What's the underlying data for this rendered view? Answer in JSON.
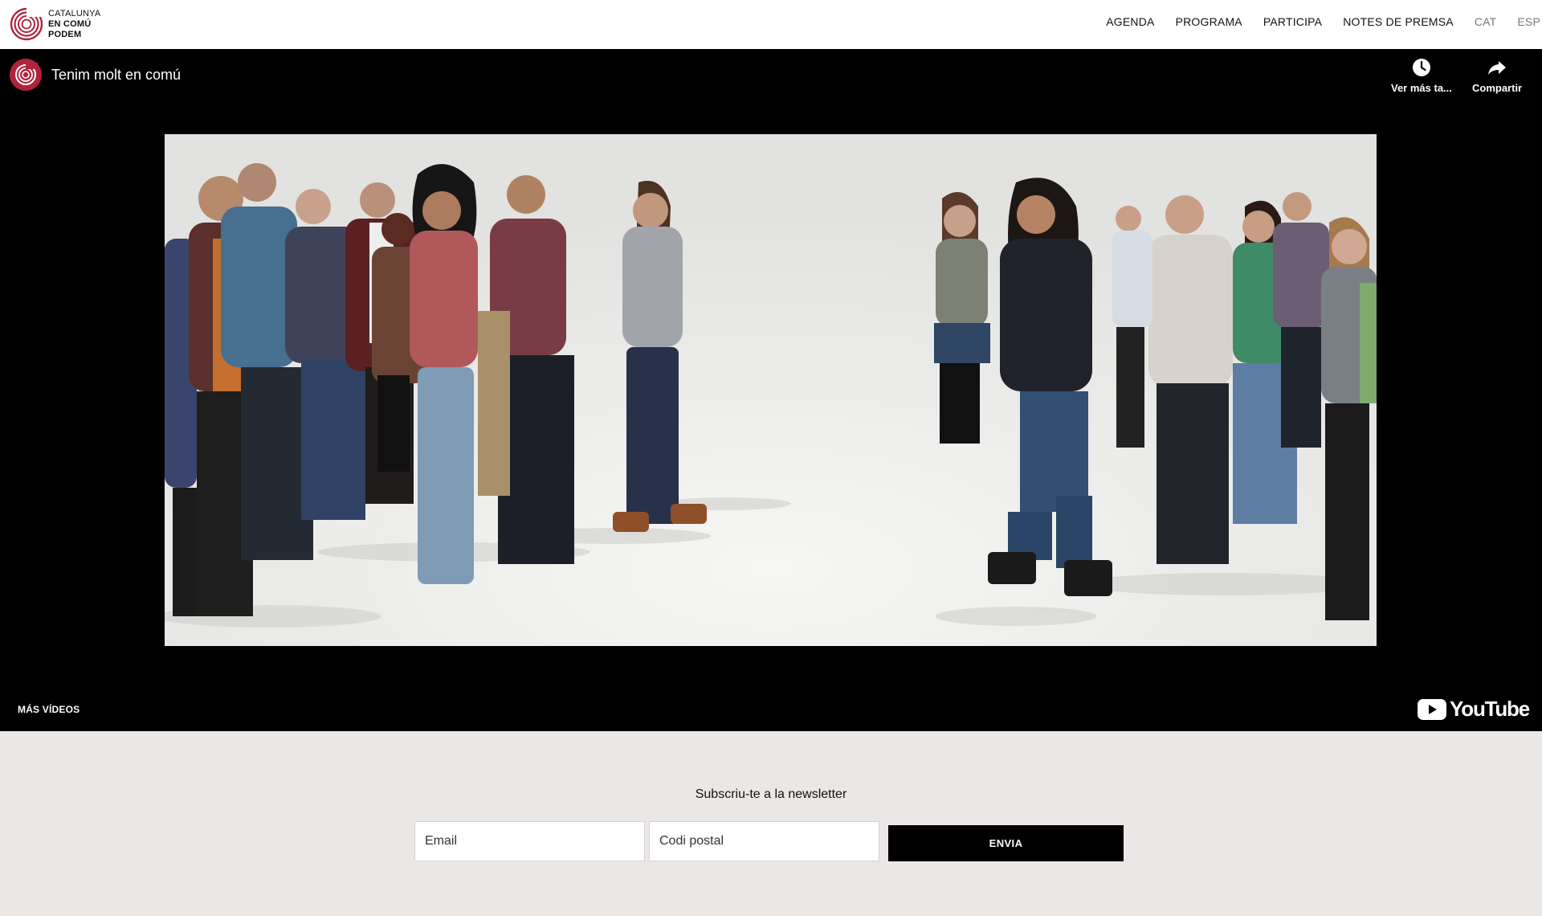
{
  "brand": {
    "logo_line1": "CATALUNYA",
    "logo_line2": "EN COMÚ",
    "logo_line3": "PODEM",
    "accent_color": "#b0233d"
  },
  "nav": {
    "items": [
      "AGENDA",
      "PROGRAMA",
      "PARTICIPA",
      "NOTES DE PREMSA"
    ],
    "languages": [
      "CAT",
      "ESP"
    ]
  },
  "video": {
    "title": "Tenim molt en comú",
    "actions": {
      "watch_later": {
        "label": "Ver más ta...",
        "icon": "clock-icon"
      },
      "share": {
        "label": "Compartir",
        "icon": "share-arrow-icon"
      }
    },
    "more_videos_label": "MÁS VÍDEOS",
    "provider_logo_text": "YouTube"
  },
  "newsletter": {
    "title": "Subscriu-te a la newsletter",
    "email_placeholder": "Email",
    "postal_placeholder": "Codi postal",
    "submit_label": "ENVIA"
  }
}
